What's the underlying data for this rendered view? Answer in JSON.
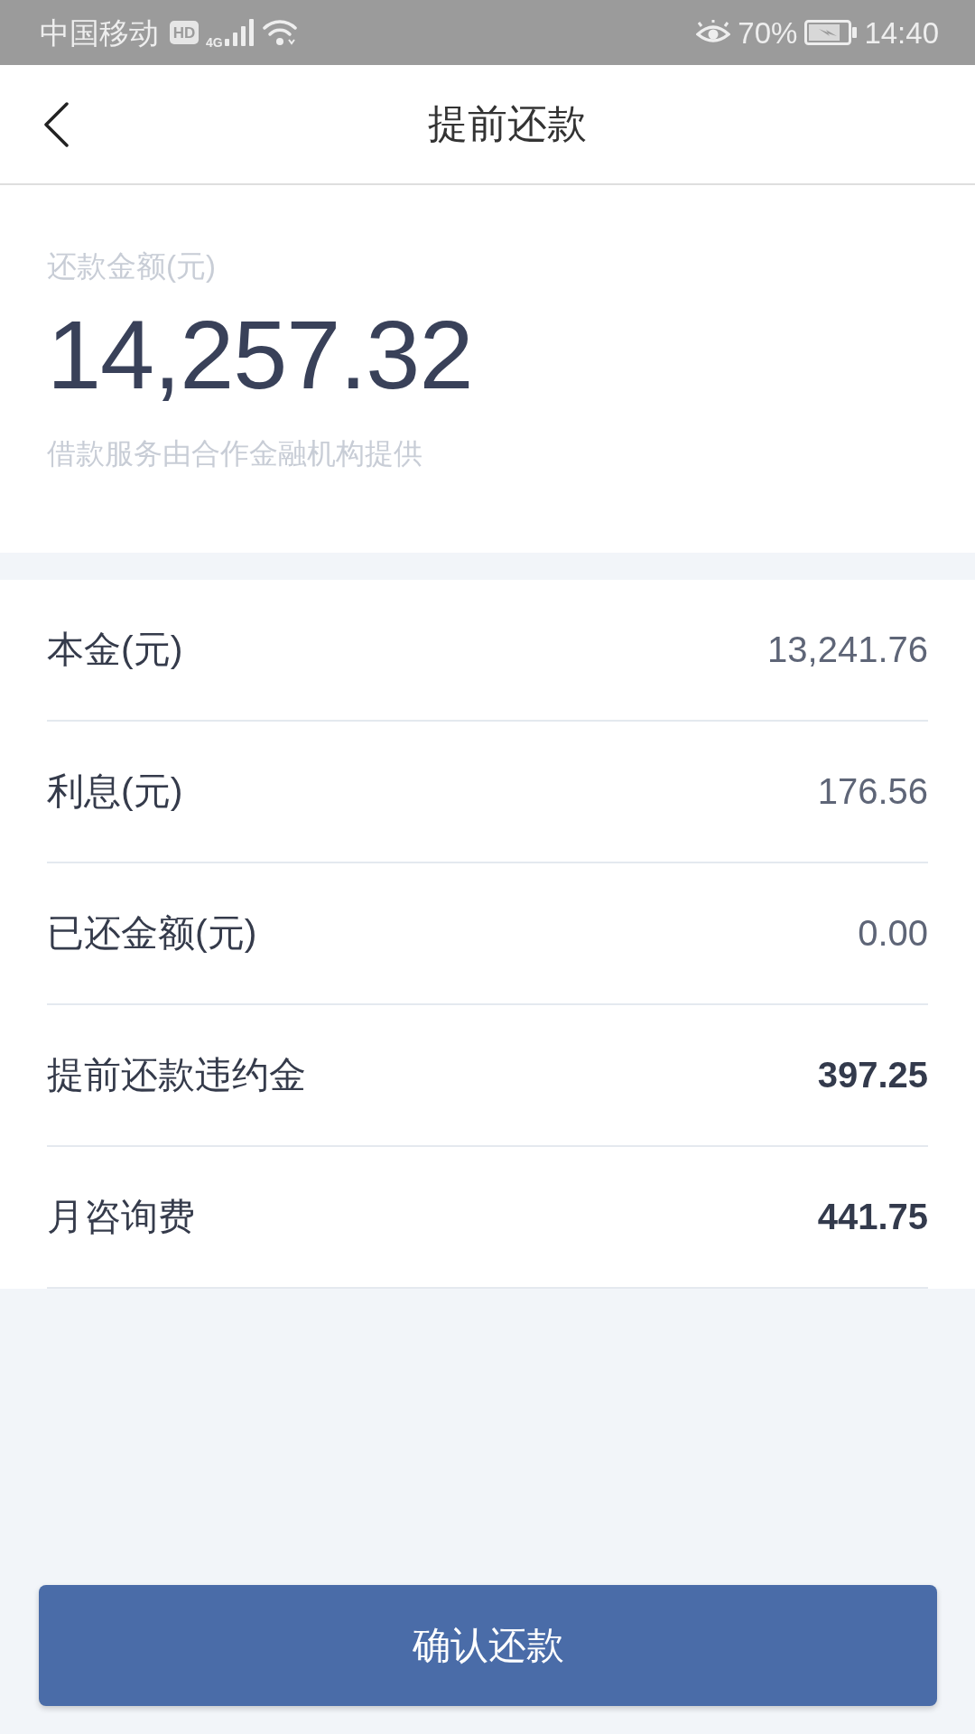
{
  "status_bar": {
    "carrier": "中国移动",
    "hd_badge": "HD",
    "network": "4G",
    "battery_percent": "70%",
    "time": "14:40"
  },
  "header": {
    "title": "提前还款"
  },
  "summary": {
    "label": "还款金额(元)",
    "amount": "14,257.32",
    "note": "借款服务由合作金融机构提供"
  },
  "details": [
    {
      "label": "本金(元)",
      "value": "13,241.76",
      "emphasized": false
    },
    {
      "label": "利息(元)",
      "value": "176.56",
      "emphasized": false
    },
    {
      "label": "已还金额(元)",
      "value": "0.00",
      "emphasized": false
    },
    {
      "label": "提前还款违约金",
      "value": "397.25",
      "emphasized": true
    },
    {
      "label": "月咨询费",
      "value": "441.75",
      "emphasized": true
    }
  ],
  "confirm_button": {
    "label": "确认还款"
  }
}
